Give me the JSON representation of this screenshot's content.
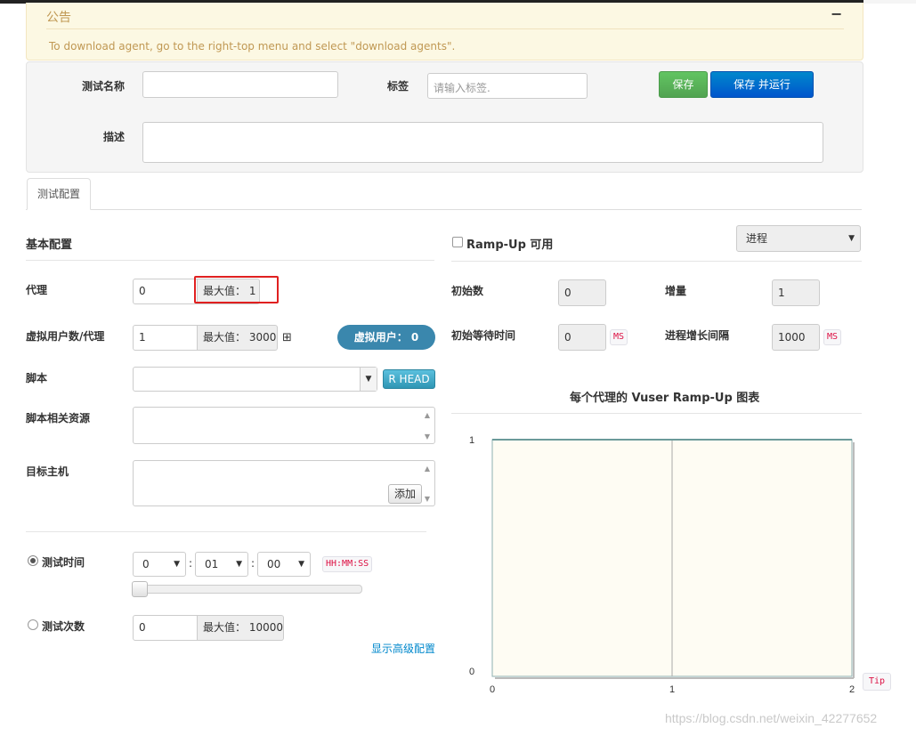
{
  "notice": {
    "title": "公告",
    "collapse": "−",
    "text": "To download agent, go to the right-top menu and select \"download agents\"."
  },
  "form": {
    "name_label": "测试名称",
    "name_value": "",
    "tag_label": "标签",
    "tag_placeholder": "请输入标签.",
    "save_label": "保存",
    "save_run_label": "保存 并运行",
    "desc_label": "描述",
    "desc_value": ""
  },
  "tabs": [
    {
      "label": "测试配置"
    }
  ],
  "basic": {
    "title": "基本配置",
    "agent_label": "代理",
    "agent_value": "0",
    "agent_max": "最大值： 1",
    "vuser_label": "虚拟用户数/代理",
    "vuser_value": "1",
    "vuser_max": "最大值： 3000",
    "expand_icon": "⊞",
    "vuser_total": "虚拟用户： 0",
    "script_label": "脚本",
    "script_value": "",
    "script_button": "R HEAD",
    "resource_label": "脚本相关资源",
    "target_label": "目标主机",
    "add_button": "添加",
    "duration_label": "测试时间",
    "duration_hh": "0",
    "duration_mm": "01",
    "duration_ss": "00",
    "duration_sep": ":",
    "duration_format": "HH:MM:SS",
    "duration_slider": 0,
    "count_label": "测试次数",
    "count_value": "0",
    "count_max": "最大值： 10000",
    "advanced_link": "显示高级配置"
  },
  "rampup": {
    "enable_label": "Ramp-Up 可用",
    "enabled": false,
    "mode": "进程",
    "init_count_label": "初始数",
    "init_count": "0",
    "increment_label": "增量",
    "increment": "1",
    "init_sleep_label": "初始等待时间",
    "init_sleep": "0",
    "interval_label": "进程增长间隔",
    "interval": "1000",
    "unit_ms": "MS"
  },
  "chart_data": {
    "type": "line",
    "title": "每个代理的 Vuser Ramp-Up 图表",
    "x": [
      0,
      1,
      2
    ],
    "series": [
      {
        "values": [
          1,
          1,
          1
        ]
      }
    ],
    "xlim": [
      0,
      2
    ],
    "ylim": [
      0,
      1
    ],
    "x_ticks": [
      "0",
      "1",
      "2"
    ],
    "y_ticks": [
      "0",
      "1"
    ],
    "tip": "Tip"
  },
  "watermark": "https://blog.csdn.net/weixin_42277652",
  "colors": {
    "accent_green": "#51a351",
    "accent_blue": "#0055cc",
    "vuser_badge": "#3a87ad"
  }
}
